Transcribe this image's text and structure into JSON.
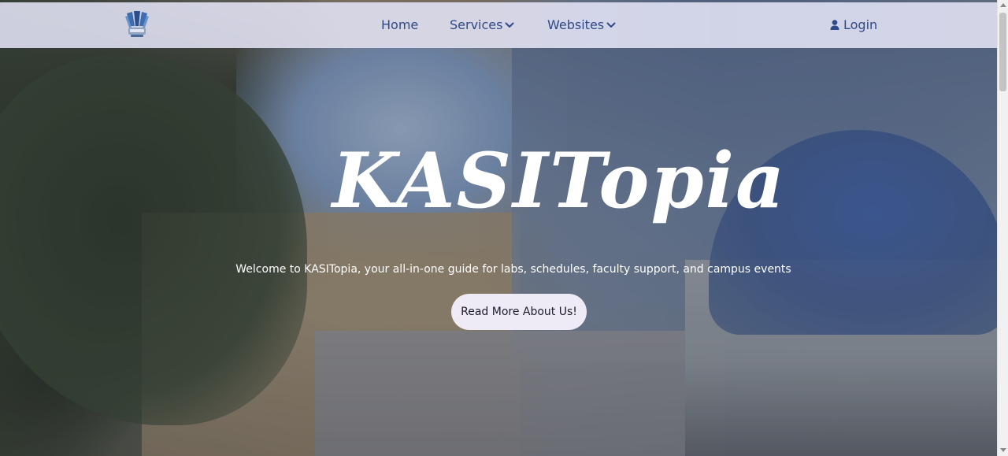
{
  "brand": {
    "logo_icon": "kasitopia-logo-icon"
  },
  "nav": {
    "home_label": "Home",
    "services_label": "Services",
    "websites_label": "Websites",
    "login_label": "Login",
    "login_icon": "user-icon",
    "dropdown_icon": "chevron-down-icon"
  },
  "hero": {
    "title": "KASITopia",
    "subtitle": "Welcome to KASITopia, your all-in-one guide for labs, schedules, faculty support, and campus events",
    "cta_label": "Read More About Us!"
  },
  "colors": {
    "nav_text": "#2f4a8a",
    "nav_background": "#e4e4f6",
    "cta_background": "#eeeaf6",
    "hero_text": "#ffffff"
  }
}
